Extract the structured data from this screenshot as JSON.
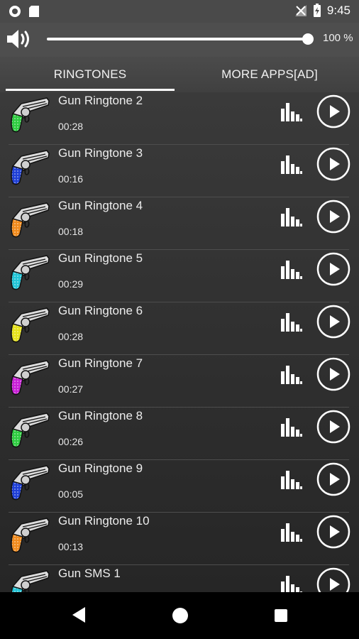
{
  "status_bar": {
    "time": "9:45",
    "icons": [
      "circle-notification-icon",
      "sd-card-icon",
      "no-signal-icon",
      "battery-charging-icon"
    ]
  },
  "volume": {
    "icon": "speaker-icon",
    "level_percent": 100,
    "label": "100 %"
  },
  "tabs": [
    {
      "label": "RINGTONES",
      "selected": true
    },
    {
      "label": "MORE APPS[AD]",
      "selected": false
    }
  ],
  "ringtones": [
    {
      "title": "Gun Ringtone 2",
      "duration": "00:28",
      "grip_color": "#2ecc40"
    },
    {
      "title": "Gun Ringtone 3",
      "duration": "00:16",
      "grip_color": "#1f3fd6"
    },
    {
      "title": "Gun Ringtone 4",
      "duration": "00:18",
      "grip_color": "#f08a1c"
    },
    {
      "title": "Gun Ringtone 5",
      "duration": "00:29",
      "grip_color": "#22c4d6"
    },
    {
      "title": "Gun Ringtone 6",
      "duration": "00:28",
      "grip_color": "#e6e21a"
    },
    {
      "title": "Gun Ringtone 7",
      "duration": "00:27",
      "grip_color": "#c81fd6"
    },
    {
      "title": "Gun Ringtone 8",
      "duration": "00:26",
      "grip_color": "#2ecc40"
    },
    {
      "title": "Gun Ringtone 9",
      "duration": "00:05",
      "grip_color": "#1f3fd6"
    },
    {
      "title": "Gun Ringtone 10",
      "duration": "00:13",
      "grip_color": "#f08a1c"
    },
    {
      "title": "Gun SMS 1",
      "duration": "",
      "grip_color": "#22c4d6"
    }
  ],
  "nav": {
    "icons": [
      "back-icon",
      "home-icon",
      "recent-apps-icon"
    ]
  }
}
